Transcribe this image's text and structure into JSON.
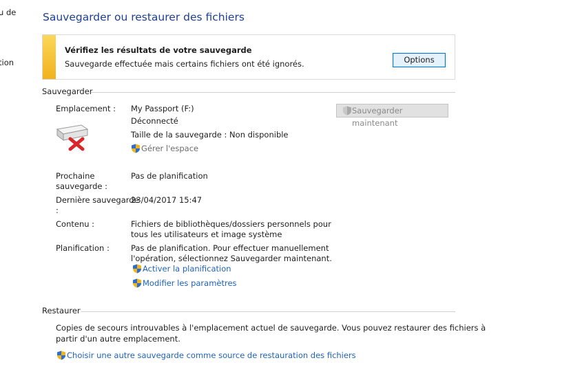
{
  "sidebar": {
    "partial_item_1": "u de",
    "partial_item_2": "tion"
  },
  "page_title": "Sauvegarder ou restaurer des fichiers",
  "banner": {
    "heading": "Vérifiez les résultats de votre sauvegarde",
    "message": "Sauvegarde effectuée mais certains fichiers ont été ignorés.",
    "options_label": "Options",
    "stripe_color": "#f5be2a"
  },
  "backup_section": {
    "heading": "Sauvegarder",
    "backup_now_label": "Sauvegarder maintenant",
    "location_label": "Emplacement :",
    "location_value": "My Passport (F:)",
    "status": "Déconnecté",
    "size_text": "Taille de la sauvegarde : Non disponible",
    "manage_space_link": "Gérer l'espace",
    "next_backup_label_line1": "Prochaine",
    "next_backup_label_line2": "sauvegarde :",
    "next_backup_value": "Pas de planification",
    "last_backup_label_line1": "Dernière sauvegarde",
    "last_backup_label_line2": ":",
    "last_backup_value": "23/04/2017 15:47",
    "content_label": "Contenu :",
    "content_line1": "Fichiers de bibliothèques/dossiers personnels pour",
    "content_line2": "tous les utilisateurs et image système",
    "schedule_label": "Planification :",
    "schedule_line1": "Pas de planification. Pour effectuer manuellement",
    "schedule_line2": "l'opération, sélectionnez Sauvegarder maintenant.",
    "enable_schedule_link": "Activer la planification",
    "change_settings_link": "Modifier les paramètres"
  },
  "restore_section": {
    "heading": "Restaurer",
    "message_line1": "Copies de secours introuvables à l'emplacement actuel de sauvegarde. Vous pouvez restaurer des fichiers à",
    "message_line2": "partir d'un autre emplacement.",
    "choose_backup_link": "Choisir une autre sauvegarde comme source de restauration des fichiers"
  },
  "icons": {
    "shield": "uac-shield-icon",
    "drive": "external-drive-disconnected-icon"
  },
  "colors": {
    "title": "#1c3f94",
    "link": "#1f63b8",
    "error_x": "#d8282a"
  }
}
